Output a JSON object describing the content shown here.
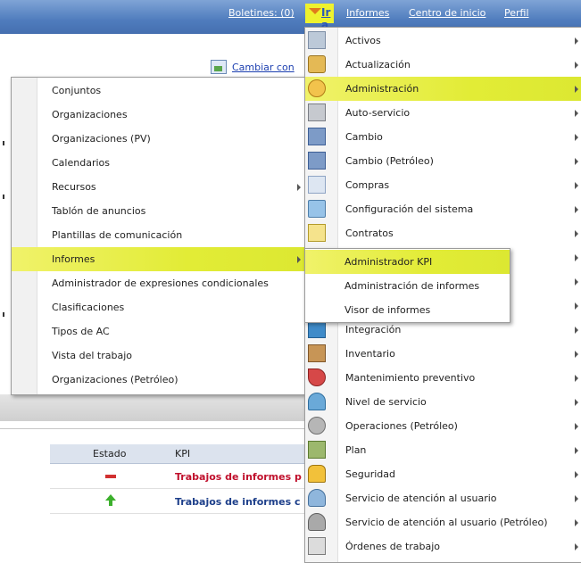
{
  "topbar": {
    "boletines": "Boletines: (0)",
    "ira": "Ir a",
    "informes": "Informes",
    "centro": "Centro de inicio",
    "perfil": "Perfil"
  },
  "page": {
    "cambiar": "Cambiar con",
    "kpi_table": {
      "headers": [
        "Estado",
        "KPI"
      ],
      "rows": [
        {
          "status_icon": "red-dash-icon",
          "kpi": "Trabajos de informes p",
          "color": "#c0102c"
        },
        {
          "status_icon": "green-up-arrow-icon",
          "kpi": "Trabajos de informes c",
          "color": "#1d3f8a"
        }
      ]
    }
  },
  "left_menu": {
    "items": [
      {
        "label": "Conjuntos"
      },
      {
        "label": "Organizaciones"
      },
      {
        "label": "Organizaciones (PV)"
      },
      {
        "label": "Calendarios"
      },
      {
        "label": "Recursos",
        "submenu": true
      },
      {
        "label": "Tablón de anuncios"
      },
      {
        "label": "Plantillas de comunicación"
      },
      {
        "label": "Informes",
        "submenu": true,
        "highlighted": true
      },
      {
        "label": "Administrador de expresiones condicionales"
      },
      {
        "label": "Clasificaciones"
      },
      {
        "label": "Tipos de AC"
      },
      {
        "label": "Vista del trabajo"
      },
      {
        "label": "Organizaciones (Petróleo)"
      }
    ]
  },
  "main_menu": {
    "items": [
      {
        "label": "Activos",
        "icon": "assets-icon"
      },
      {
        "label": "Actualización",
        "icon": "update-icon"
      },
      {
        "label": "Administración",
        "icon": "administration-icon",
        "highlighted": true
      },
      {
        "label": "Auto-servicio",
        "icon": "self-service-cart-icon"
      },
      {
        "label": "Cambio",
        "icon": "change-icon"
      },
      {
        "label": "Cambio (Petróleo)",
        "icon": "change-oil-icon"
      },
      {
        "label": "Compras",
        "icon": "purchasing-icon"
      },
      {
        "label": "Configuración del sistema",
        "icon": "system-config-icon"
      },
      {
        "label": "Contratos",
        "icon": "contracts-icon"
      },
      {
        "label": "",
        "icon": ""
      },
      {
        "label": "",
        "icon": ""
      },
      {
        "label": "",
        "icon": ""
      },
      {
        "label": "Integración",
        "icon": "integration-icon"
      },
      {
        "label": "Inventario",
        "icon": "inventory-icon"
      },
      {
        "label": "Mantenimiento preventivo",
        "icon": "preventive-maintenance-icon"
      },
      {
        "label": "Nivel de servicio",
        "icon": "service-level-icon"
      },
      {
        "label": "Operaciones (Petróleo)",
        "icon": "oil-operations-icon"
      },
      {
        "label": "Plan",
        "icon": "plan-icon"
      },
      {
        "label": "Seguridad",
        "icon": "security-lock-icon"
      },
      {
        "label": "Servicio de atención al usuario",
        "icon": "service-desk-bell-icon"
      },
      {
        "label": "Servicio de atención al usuario (Petróleo)",
        "icon": "service-desk-oil-icon"
      },
      {
        "label": "Órdenes de trabajo",
        "icon": "work-orders-icon"
      }
    ]
  },
  "sub_menu": {
    "items": [
      {
        "label": "Administrador KPI",
        "highlighted": true
      },
      {
        "label": "Administración de informes"
      },
      {
        "label": "Visor de informes"
      }
    ]
  },
  "colors": {
    "topbar": "#4f7cbd",
    "highlight": "#e2ec36",
    "link": "#1c3fb0"
  }
}
